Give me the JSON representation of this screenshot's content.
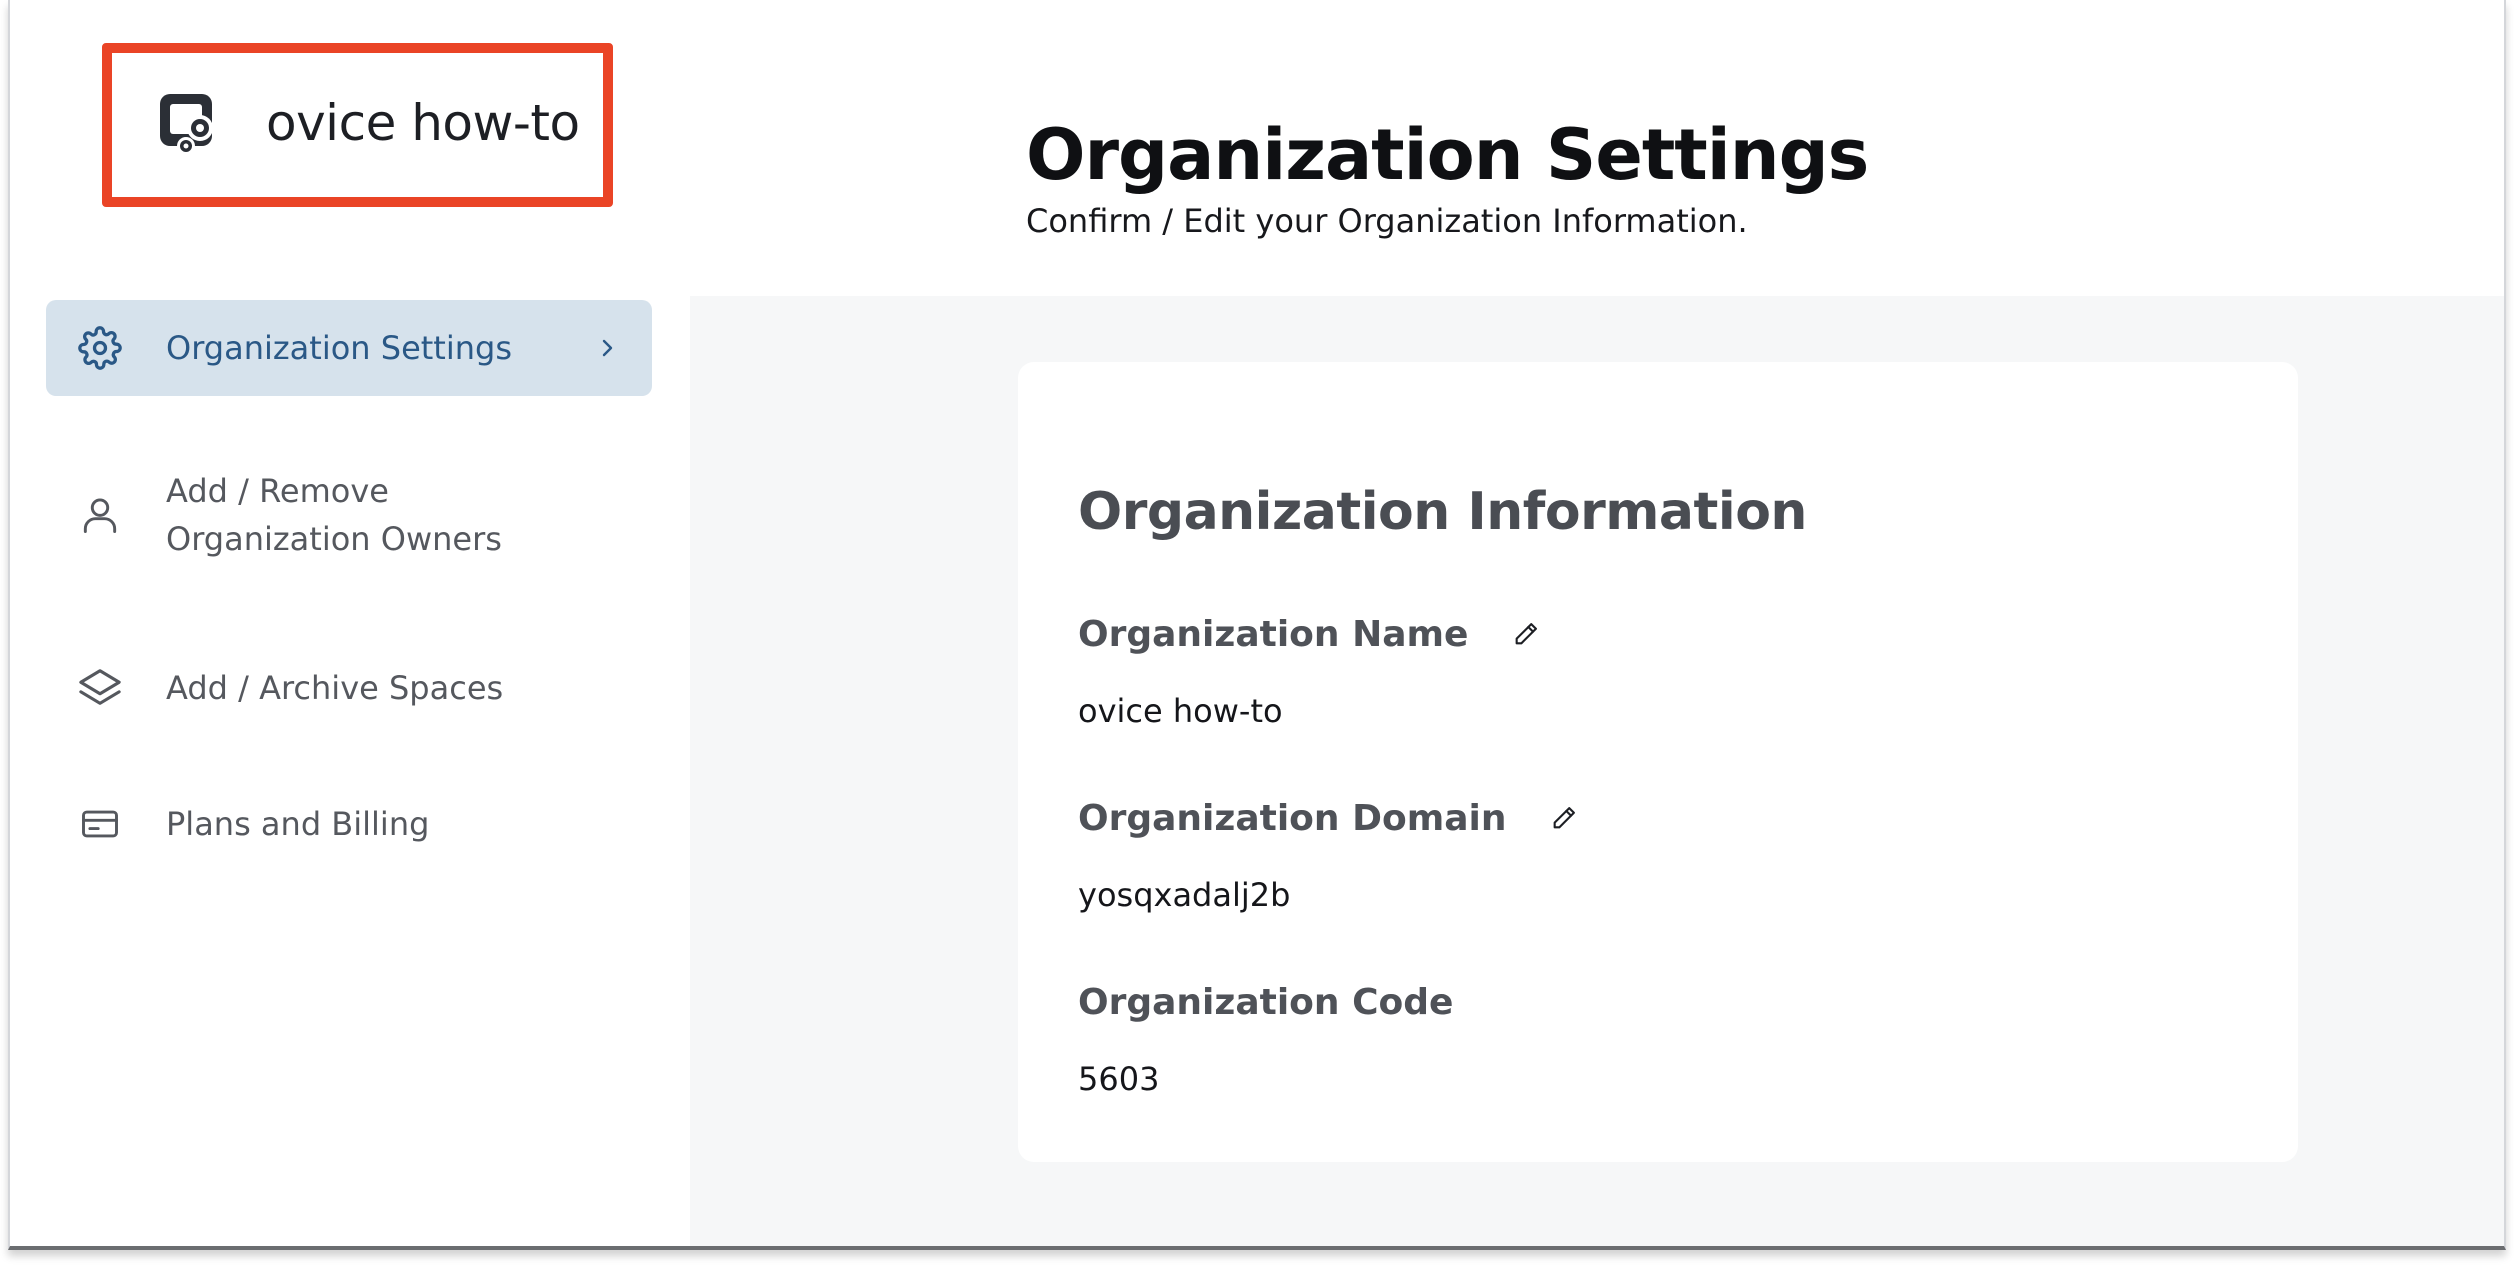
{
  "brand": {
    "name": "ovice how-to",
    "icon": "organization-logo-icon",
    "highlight_color": "#ea4426"
  },
  "header": {
    "title": "Organization Settings",
    "subtitle": "Confirm / Edit your Organization Information."
  },
  "sidebar": {
    "items": [
      {
        "label": "Organization Settings",
        "icon": "gear-icon",
        "active": true
      },
      {
        "label_line1": "Add / Remove",
        "label_line2": "Organization Owners",
        "icon": "user-icon"
      },
      {
        "label": "Add / Archive Spaces",
        "icon": "layers-icon"
      },
      {
        "label": "Plans and Billing",
        "icon": "credit-card-icon"
      }
    ]
  },
  "main": {
    "card_title": "Organization Information",
    "fields": [
      {
        "label": "Organization Name",
        "value": "ovice how-to",
        "editable": true
      },
      {
        "label": "Organization Domain",
        "value": "yosqxadalj2b",
        "editable": true
      },
      {
        "label": "Organization Code",
        "value": "5603",
        "editable": false
      }
    ]
  },
  "colors": {
    "active_nav_bg": "#d6e2ec",
    "active_nav_text": "#2a5886",
    "content_bg": "#f6f7f8"
  }
}
